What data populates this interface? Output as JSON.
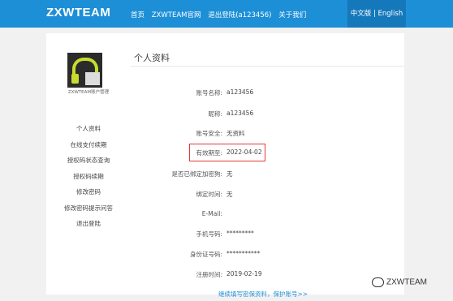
{
  "header": {
    "logo": "ZXWTEAM",
    "nav": [
      "首页",
      "ZXWTEAM官网",
      "退出登陆(a123456)",
      "关于我们"
    ],
    "lang": "中文版 | English",
    "colors": {
      "bar": "#1d8fd6",
      "lang_bg": "#1578bb"
    }
  },
  "sidebar": {
    "avatar_icon": "headphones-avatar",
    "caption": "ZXWTEAM账户管理",
    "items": [
      "个人资料",
      "在线支付续期",
      "授权码状态查询",
      "授权码续期",
      "修改密码",
      "修改密码提示问答",
      "退出登陆"
    ]
  },
  "main": {
    "title": "个人资料",
    "fields": [
      {
        "label": "账号名称:",
        "value": "a123456"
      },
      {
        "label": "昵称:",
        "value": "a123456"
      },
      {
        "label": "账号安全:",
        "value": "无资料"
      },
      {
        "label": "有效期至:",
        "value": "2022-04-02"
      },
      {
        "label": "是否已绑定加密狗:",
        "value": "无"
      },
      {
        "label": "绑定时间:",
        "value": "无"
      },
      {
        "label": "E-Mail:",
        "value": ""
      },
      {
        "label": "手机号码:",
        "value": "*********"
      },
      {
        "label": "身份证号码:",
        "value": "***********"
      },
      {
        "label": "注册时间:",
        "value": "2019-02-19"
      }
    ],
    "highlight_color": "#e13b3b",
    "bottom_link": "继续填写密保资料，保护账号>>"
  },
  "watermark": {
    "icon": "wechat-icon",
    "text": "ZXWTEAM"
  }
}
